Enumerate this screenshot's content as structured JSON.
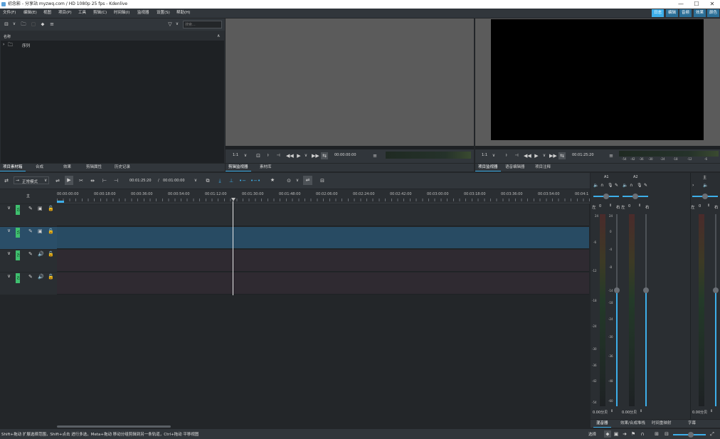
{
  "window": {
    "title": "初念影 - 分享站 myzwq.com / HD 1080p 25 fps - Kdenlive",
    "min_icon": "minimize-icon",
    "max_icon": "maximize-icon",
    "close_icon": "close-icon",
    "min_glyph": "—",
    "max_glyph": "☐",
    "close_glyph": "✕"
  },
  "menu": [
    "文件(F)",
    "编辑(E)",
    "视图",
    "项目(P)",
    "工具",
    "剪辑(C)",
    "时间轴(I)",
    "监视器",
    "设置(S)",
    "帮助(H)"
  ],
  "workspaces": [
    "日志",
    "编辑",
    "音频",
    "效果",
    "颜色"
  ],
  "bin": {
    "search_placeholder": "搜索...",
    "column_name": "名称",
    "item": "序列"
  },
  "left_tabs": [
    "项目素材箱",
    "合成",
    "效果",
    "剪辑属性",
    "历史记录"
  ],
  "clip_monitor": {
    "zoom": "1:1",
    "timecode": "00:00:00:00",
    "tabs": [
      "剪辑监视器",
      "素材库"
    ]
  },
  "project_monitor": {
    "zoom": "1:1",
    "timecode": "00:01:25:20",
    "scale": [
      "-54",
      "-42",
      "-36",
      "-30",
      "-24",
      "-18",
      "-12",
      "-6"
    ],
    "tabs": [
      "项目监视器",
      "语音编辑器",
      "项目注释"
    ]
  },
  "timeline_toolbar": {
    "mode": "正常模式",
    "position": "00:01:25:20",
    "separator": "/",
    "duration": "00:01:00:00"
  },
  "ruler": [
    "00:00:00:00",
    "00:00:18:00",
    "00:00:36:00",
    "00:00:54:00",
    "00:01:12:00",
    "00:01:30:00",
    "00:01:48:00",
    "00:02:06:00",
    "00:02:24:00",
    "00:02:42:00",
    "00:03:00:00",
    "00:03:18:00",
    "00:03:36:00",
    "00:03:54:00",
    "00:04:1"
  ],
  "master_label": "主",
  "tracks": [
    {
      "name": "V2",
      "type": "video"
    },
    {
      "name": "V1",
      "type": "video"
    },
    {
      "name": "A1",
      "type": "audio"
    },
    {
      "name": "A2",
      "type": "audio"
    }
  ],
  "mixer": {
    "channels": [
      "A1",
      "A2",
      "主"
    ],
    "left_lbl": "左",
    "right_lbl": "右",
    "pan_value": "0",
    "db_values": [
      "0.00分贝",
      "0.00分贝",
      "0.00分贝"
    ],
    "scale": [
      "24",
      "-6",
      "-12",
      "-18",
      "-24",
      "-30",
      "-36",
      "-42",
      "-54"
    ],
    "scale_right": [
      "24",
      "0",
      "-4",
      "-8",
      "-14",
      "-18",
      "-24",
      "-30",
      "-36",
      "-48",
      "-60"
    ],
    "tabs": [
      "混音器",
      "效果/合成堆栈",
      "时间重映射",
      "字幕"
    ]
  },
  "status": {
    "hint": "Shift+拖动 扩展选择范围，Shift+点击 进行多选，Meta+拖动 移动分组剪辑到另一条轨道，Ctrl+拖动 平移视图",
    "select_label": "选择"
  },
  "colors": {
    "accent": "#3daee9",
    "track_selected": "#284b63",
    "video_track": "#2a2e32",
    "audio_track": "#2f2a31",
    "track_tag": "#3fbf6f"
  }
}
